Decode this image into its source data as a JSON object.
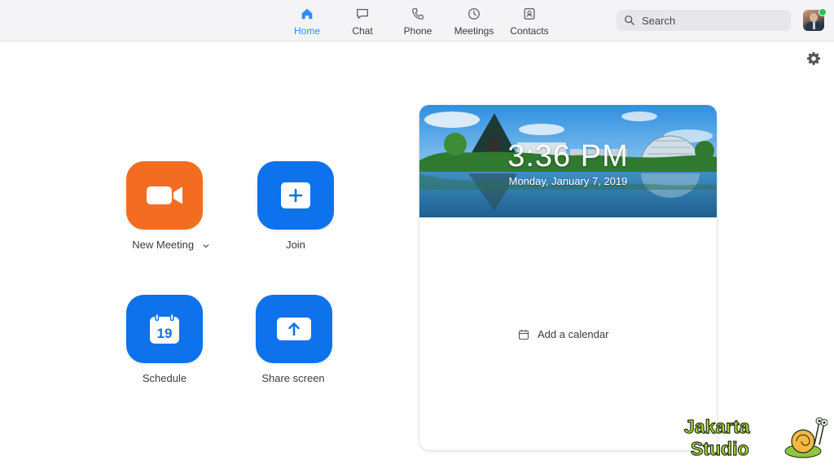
{
  "nav": {
    "tabs": [
      {
        "label": "Home",
        "icon": "home-icon",
        "active": true
      },
      {
        "label": "Chat",
        "icon": "chat-icon",
        "active": false
      },
      {
        "label": "Phone",
        "icon": "phone-icon",
        "active": false
      },
      {
        "label": "Meetings",
        "icon": "clock-icon",
        "active": false
      },
      {
        "label": "Contacts",
        "icon": "contacts-icon",
        "active": false
      }
    ],
    "search_placeholder": "Search",
    "accent_color": "#2d8cff"
  },
  "actions": {
    "new_meeting": {
      "label": "New Meeting",
      "icon": "video-camera-icon",
      "color": "#f26d21"
    },
    "join": {
      "label": "Join",
      "icon": "plus-icon",
      "color": "#0e72ed"
    },
    "schedule": {
      "label": "Schedule",
      "icon": "calendar-icon",
      "day": "19",
      "color": "#0e72ed"
    },
    "share_screen": {
      "label": "Share screen",
      "icon": "upload-arrow-icon",
      "color": "#0e72ed"
    }
  },
  "calendar_card": {
    "time": "3:36 PM",
    "date": "Monday, January 7, 2019",
    "add_calendar_label": "Add a calendar"
  },
  "watermark": {
    "line1": "Jakarta",
    "line2": "Studio"
  }
}
